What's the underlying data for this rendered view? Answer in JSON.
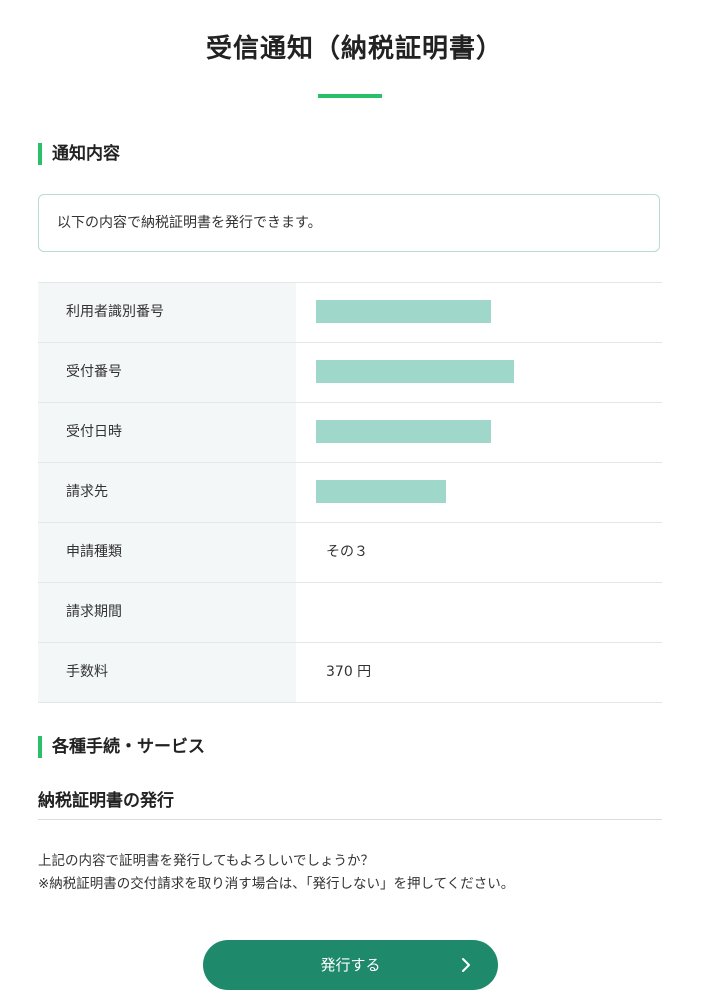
{
  "page": {
    "title": "受信通知（納税証明書）"
  },
  "notice": {
    "heading": "通知内容",
    "message": "以下の内容で納税証明書を発行できます。"
  },
  "details": [
    {
      "label": "利用者識別番号",
      "value": "",
      "redacted": true
    },
    {
      "label": "受付番号",
      "value": "",
      "redacted": true
    },
    {
      "label": "受付日時",
      "value": "",
      "redacted": true
    },
    {
      "label": "請求先",
      "value": "",
      "redacted": true
    },
    {
      "label": "申請種類",
      "value": "その３",
      "redacted": false
    },
    {
      "label": "請求期間",
      "value": "",
      "redacted": false
    },
    {
      "label": "手数料",
      "value": "370 円",
      "redacted": false
    }
  ],
  "services": {
    "heading": "各種手続・サービス",
    "subheading": "納税証明書の発行",
    "line1": "上記の内容で証明書を発行してもよろしいでしょうか？",
    "line2": "※納税証明書の交付請求を取り消す場合は、「発行しない」を押してください。",
    "button_label": "発行する",
    "button_icon": "chevron-right-icon"
  },
  "colors": {
    "accent": "#2bbf6a",
    "button": "#1f8a6b",
    "redaction": "#9fd8cb",
    "label_bg": "#f4f7f8"
  }
}
